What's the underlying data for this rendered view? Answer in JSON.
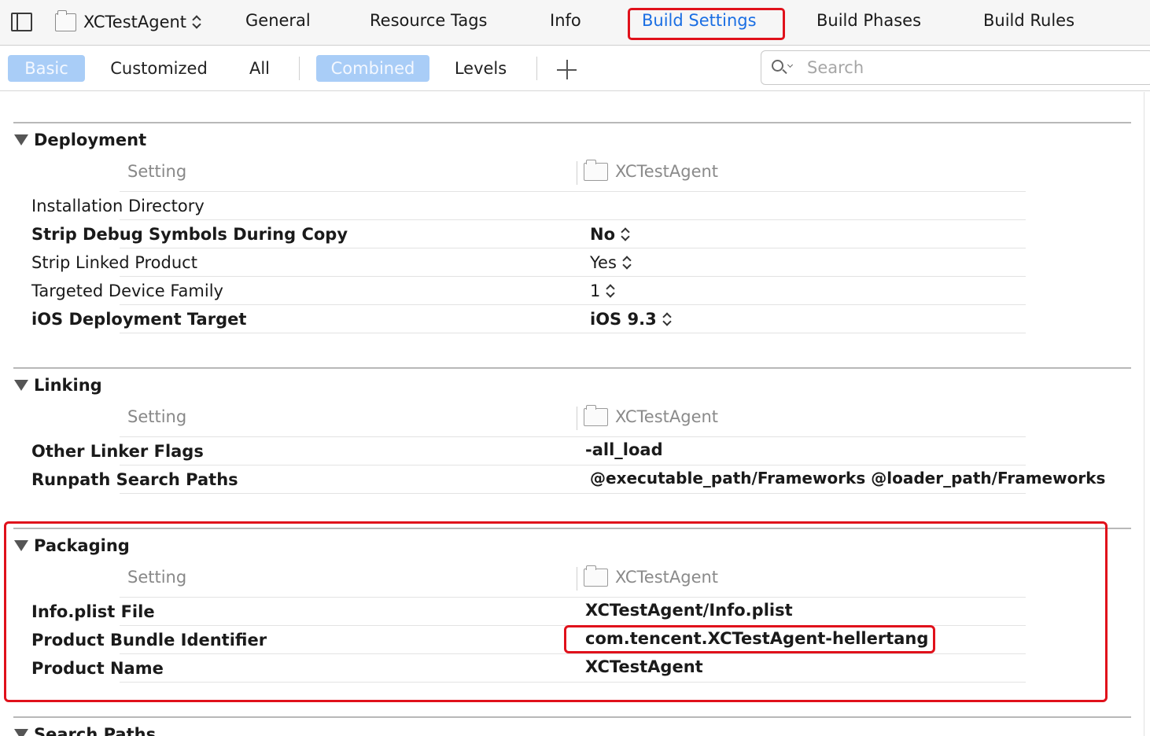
{
  "toolbar": {
    "target_name": "XCTestAgent",
    "tabs": [
      "General",
      "Resource Tags",
      "Info",
      "Build Settings",
      "Build Phases",
      "Build Rules"
    ],
    "active_tab": "Build Settings"
  },
  "filter": {
    "scope_options": [
      "Basic",
      "Customized",
      "All"
    ],
    "scope_selected": "Basic",
    "view_options": [
      "Combined",
      "Levels"
    ],
    "view_selected": "Combined",
    "search_placeholder": "Search"
  },
  "column_headers": {
    "setting": "Setting",
    "target": "XCTestAgent"
  },
  "sections": {
    "deployment": {
      "title": "Deployment",
      "rows": [
        {
          "label": "Installation Directory",
          "value": ""
        },
        {
          "label": "Strip Debug Symbols During Copy",
          "value": "No"
        },
        {
          "label": "Strip Linked Product",
          "value": "Yes"
        },
        {
          "label": "Targeted Device Family",
          "value": "1"
        },
        {
          "label": "iOS Deployment Target",
          "value": "iOS 9.3"
        }
      ]
    },
    "linking": {
      "title": "Linking",
      "rows": [
        {
          "label": "Other Linker Flags",
          "value": "-all_load"
        },
        {
          "label": "Runpath Search Paths",
          "value": "@executable_path/Frameworks @loader_path/Frameworks"
        }
      ]
    },
    "packaging": {
      "title": "Packaging",
      "rows": [
        {
          "label": "Info.plist File",
          "value": "XCTestAgent/Info.plist"
        },
        {
          "label": "Product Bundle Identifier",
          "value": "com.tencent.XCTestAgent-hellertang"
        },
        {
          "label": "Product Name",
          "value": "XCTestAgent"
        }
      ]
    },
    "search_paths": {
      "title": "Search Paths"
    }
  },
  "colors": {
    "accent": "#1a6ee3",
    "selected_segment": "#a9cdf7",
    "highlight": "#e0111b"
  }
}
